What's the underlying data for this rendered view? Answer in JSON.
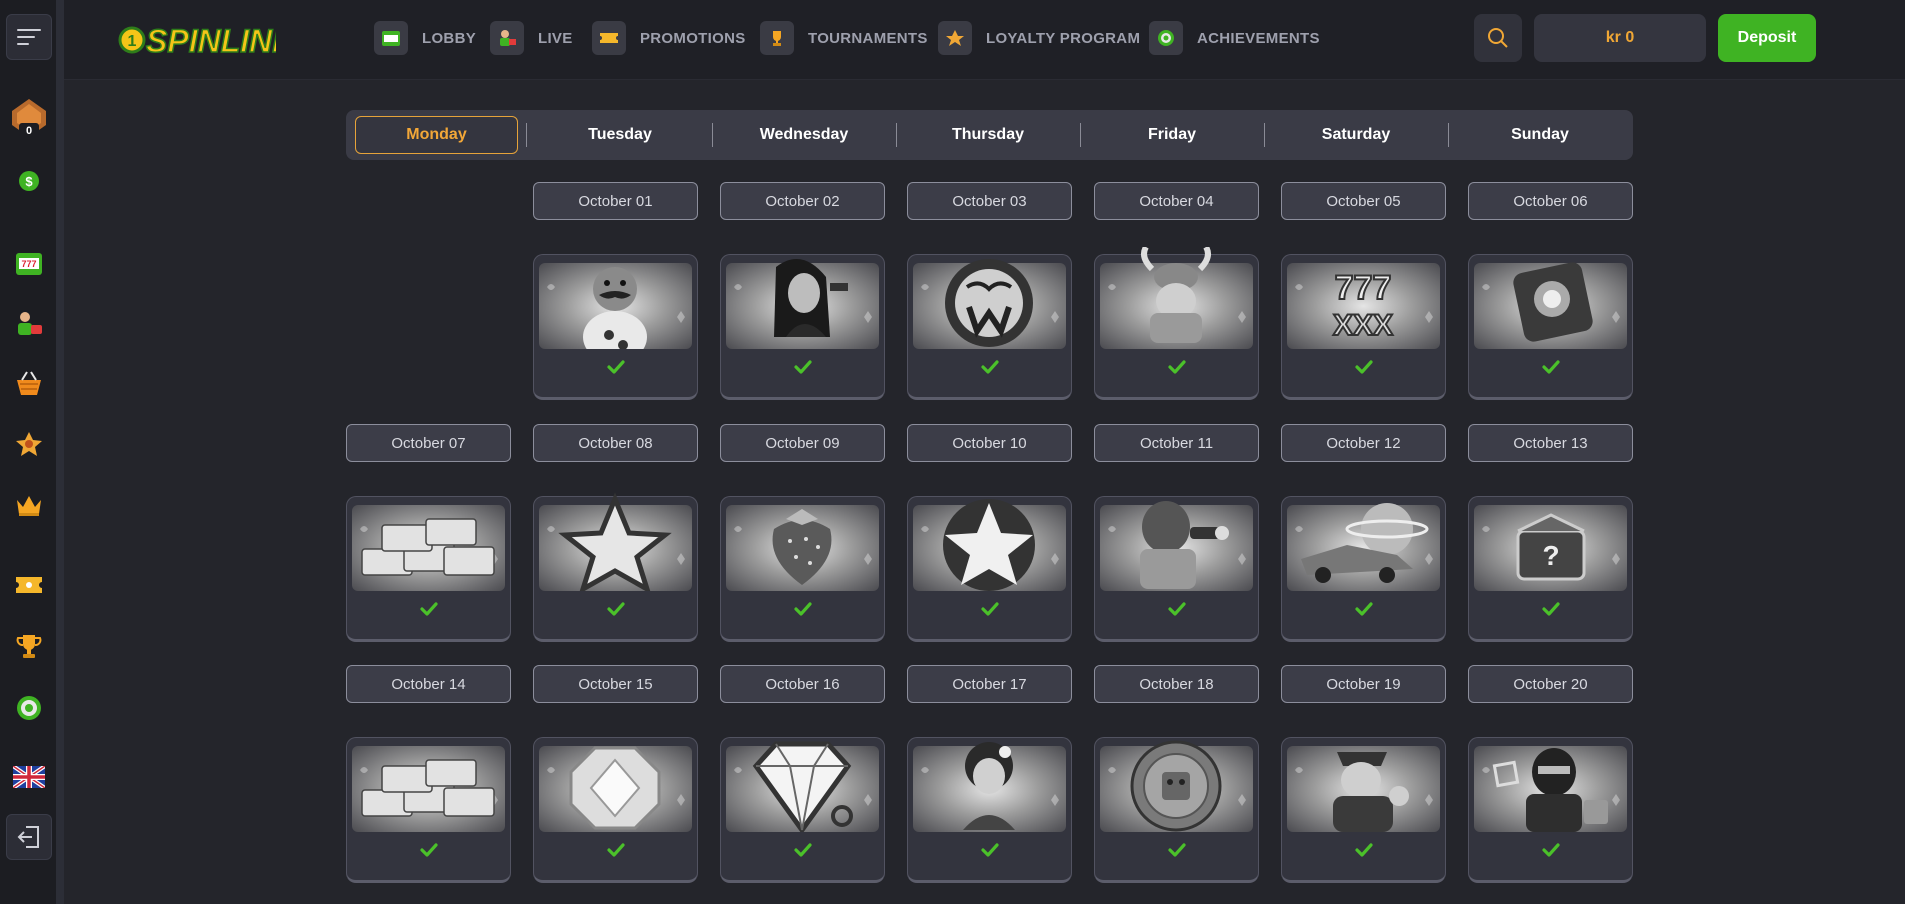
{
  "header": {
    "logo_text": "SPINLINE",
    "nav": [
      {
        "label": "LOBBY",
        "icon": "slot-machine-icon"
      },
      {
        "label": "LIVE",
        "icon": "live-dealer-icon"
      },
      {
        "label": "PROMOTIONS",
        "icon": "ticket-icon"
      },
      {
        "label": "TOURNAMENTS",
        "icon": "trophy-icon"
      },
      {
        "label": "LOYALTY PROGRAM",
        "icon": "loyalty-badge-icon"
      },
      {
        "label": "ACHIEVEMENTS",
        "icon": "target-icon"
      }
    ],
    "balance": "kr 0",
    "deposit_label": "Deposit"
  },
  "sidebar": {
    "level_badge": "0",
    "items": [
      "level-badge-icon",
      "coin-icon",
      "slot-machine-icon",
      "live-dealer-icon",
      "basket-icon",
      "loyalty-badge-icon",
      "crown-icon",
      "ticket-icon",
      "trophy-icon",
      "target-icon",
      "uk-flag-icon",
      "logout-icon"
    ]
  },
  "days": [
    "Monday",
    "Tuesday",
    "Wednesday",
    "Thursday",
    "Friday",
    "Saturday",
    "Sunday"
  ],
  "active_day": "Monday",
  "calendar": [
    {
      "date": "October 01",
      "reward": "mustache-man",
      "claimed": true
    },
    {
      "date": "October 02",
      "reward": "woman-with-gun",
      "claimed": true
    },
    {
      "date": "October 03",
      "reward": "daruma-w",
      "claimed": true
    },
    {
      "date": "October 04",
      "reward": "viking",
      "claimed": true
    },
    {
      "date": "October 05",
      "reward": "777-xxx",
      "claimed": true
    },
    {
      "date": "October 06",
      "reward": "gem-box",
      "claimed": true
    },
    {
      "date": "October 07",
      "reward": "cash-stacks",
      "claimed": true
    },
    {
      "date": "October 08",
      "reward": "star",
      "claimed": true
    },
    {
      "date": "October 09",
      "reward": "strawberry",
      "claimed": true
    },
    {
      "date": "October 10",
      "reward": "star-coin",
      "claimed": true
    },
    {
      "date": "October 11",
      "reward": "spy",
      "claimed": true
    },
    {
      "date": "October 12",
      "reward": "race-car-planet",
      "claimed": true
    },
    {
      "date": "October 13",
      "reward": "mystery-box",
      "claimed": true
    },
    {
      "date": "October 14",
      "reward": "cash-stacks",
      "claimed": true
    },
    {
      "date": "October 15",
      "reward": "diamond-octagon",
      "claimed": true
    },
    {
      "date": "October 16",
      "reward": "diamond",
      "claimed": true
    },
    {
      "date": "October 17",
      "reward": "pinup-girl",
      "claimed": true
    },
    {
      "date": "October 18",
      "reward": "aztec-coin",
      "claimed": true
    },
    {
      "date": "October 19",
      "reward": "police-officer",
      "claimed": true
    },
    {
      "date": "October 20",
      "reward": "ninja",
      "claimed": true
    }
  ],
  "colors": {
    "accent": "#f2a738",
    "deposit": "#3fb323",
    "check": "#4bc12a"
  }
}
